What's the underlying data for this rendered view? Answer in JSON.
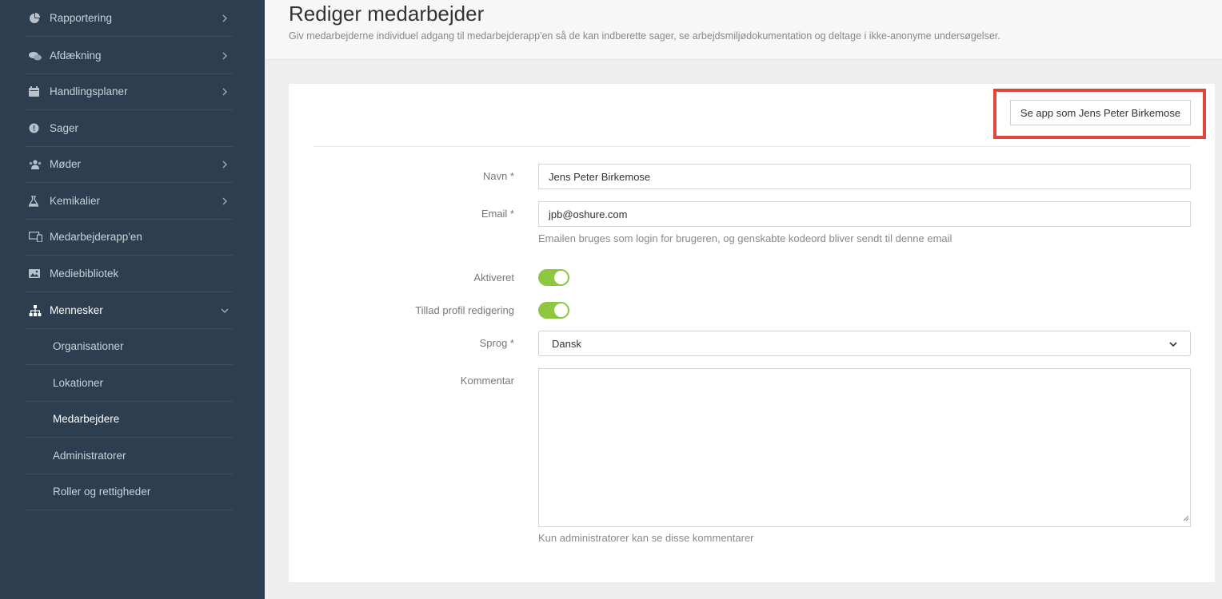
{
  "sidebar": {
    "items": [
      {
        "label": "Rapportering",
        "icon": "pie-chart-icon",
        "has_chevron": true
      },
      {
        "label": "Afdækning",
        "icon": "chat-bubbles-icon",
        "has_chevron": true
      },
      {
        "label": "Handlingsplaner",
        "icon": "calendar-icon",
        "has_chevron": true
      },
      {
        "label": "Sager",
        "icon": "alert-circle-icon",
        "has_chevron": false
      },
      {
        "label": "Møder",
        "icon": "users-icon",
        "has_chevron": true
      },
      {
        "label": "Kemikalier",
        "icon": "flask-icon",
        "has_chevron": true
      },
      {
        "label": "Medarbejderapp'en",
        "icon": "devices-icon",
        "has_chevron": false
      },
      {
        "label": "Mediebibliotek",
        "icon": "image-icon",
        "has_chevron": false
      },
      {
        "label": "Mennesker",
        "icon": "org-chart-icon",
        "has_chevron": true,
        "expanded": true
      }
    ],
    "subitems": [
      {
        "label": "Organisationer"
      },
      {
        "label": "Lokationer"
      },
      {
        "label": "Medarbejdere",
        "active": true
      },
      {
        "label": "Administratorer"
      },
      {
        "label": "Roller og rettigheder"
      }
    ]
  },
  "header": {
    "title": "Rediger medarbejder",
    "subtitle": "Giv medarbejderne individuel adgang til medarbejderapp'en så de kan indberette sager, se arbejdsmiljødokumentation og deltage i ikke-anonyme undersøgelser."
  },
  "form": {
    "view_app_button": "Se app som Jens Peter Birkemose",
    "name_label": "Navn *",
    "name_value": "Jens Peter Birkemose",
    "email_label": "Email *",
    "email_value": "jpb@oshure.com",
    "email_help": "Emailen bruges som login for brugeren, og genskabte kodeord bliver sendt til denne email",
    "activated_label": "Aktiveret",
    "activated_on": true,
    "profile_edit_label": "Tillad profil redigering",
    "profile_edit_on": true,
    "language_label": "Sprog *",
    "language_value": "Dansk",
    "comment_label": "Kommentar",
    "comment_value": "",
    "comment_help": "Kun administratorer kan se disse kommentarer"
  },
  "colors": {
    "sidebar_bg": "#2c3e50",
    "toggle_on": "#8dc63f",
    "highlight": "#e0473b"
  }
}
